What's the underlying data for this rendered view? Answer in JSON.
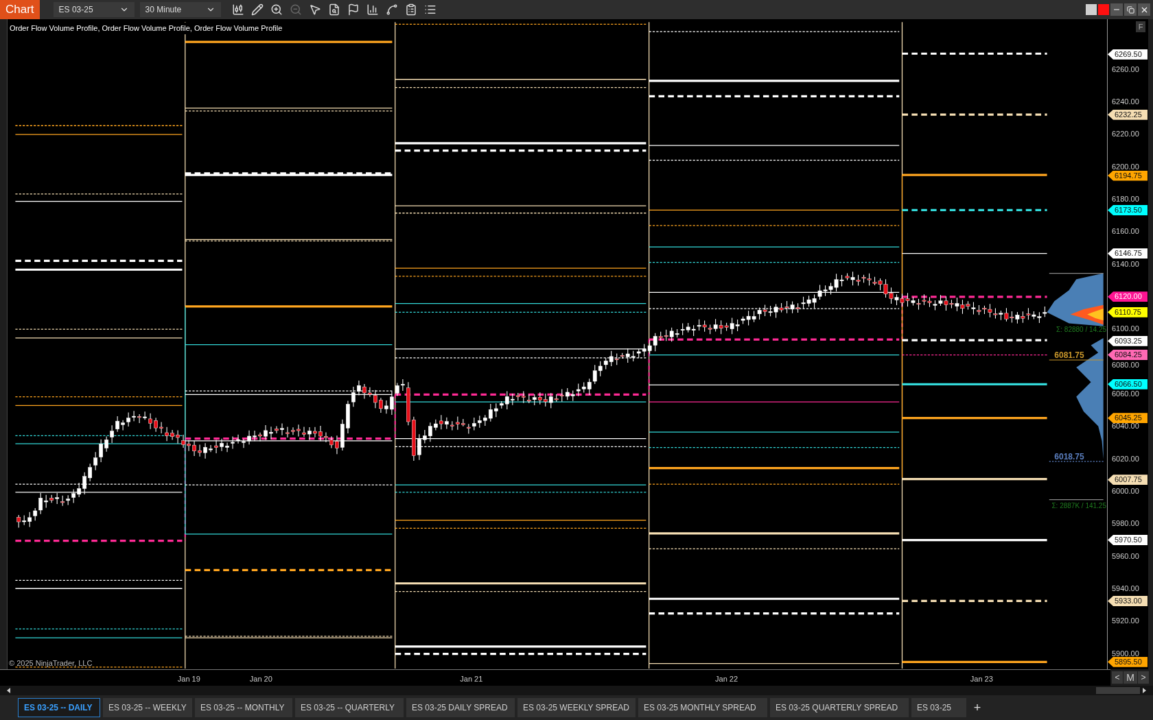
{
  "window": {
    "title": "Chart"
  },
  "toolbar": {
    "instrument": "ES 03-25",
    "interval": "30 Minute"
  },
  "chart": {
    "indicator_label": "Order Flow Volume Profile, Order Flow Volume Profile, Order Flow Volume Profile",
    "copyright": "© 2025 NinjaTrader, LLC",
    "corner_button": "F",
    "profile_labels": [
      {
        "text": "Σ: 82880 / 14.25",
        "color": "#1f7a1f"
      },
      {
        "text": "6081.75",
        "color": "#c8962a"
      },
      {
        "text": "6018.75",
        "color": "#5b7fc0"
      },
      {
        "text": "Σ: 2887K / 141.25",
        "color": "#1f7a1f"
      }
    ]
  },
  "price_axis": {
    "ticks": [
      "6260.00",
      "6240.00",
      "6220.00",
      "6200.00",
      "6180.00",
      "6160.00",
      "6140.00",
      "6100.00",
      "6080.00",
      "6060.00",
      "6040.00",
      "6020.00",
      "6000.00",
      "5980.00",
      "5960.00",
      "5940.00",
      "5920.00",
      "5900.00"
    ],
    "price_tags": [
      {
        "text": "6269.50",
        "color": "#ffffff"
      },
      {
        "text": "6232.25",
        "color": "#f5deb3"
      },
      {
        "text": "6194.75",
        "color": "#ffa500"
      },
      {
        "text": "6173.50",
        "color": "#00ffff"
      },
      {
        "text": "6146.75",
        "color": "#ffffff"
      },
      {
        "text": "6120.00",
        "color": "#ff1493"
      },
      {
        "text": "6110.75",
        "color": "#ffff00"
      },
      {
        "text": "6093.25",
        "color": "#ffffff"
      },
      {
        "text": "6084.25",
        "color": "#ff69b4"
      },
      {
        "text": "6066.50",
        "color": "#00ffff"
      },
      {
        "text": "6045.25",
        "color": "#ffa500"
      },
      {
        "text": "6007.75",
        "color": "#f5deb3"
      },
      {
        "text": "5970.50",
        "color": "#ffffff"
      },
      {
        "text": "5933.00",
        "color": "#f5deb3"
      },
      {
        "text": "5895.50",
        "color": "#ffa500"
      }
    ]
  },
  "time_axis": {
    "labels": [
      "Jan 19",
      "Jan 20",
      "Jan 21",
      "Jan 22",
      "Jan 23"
    ]
  },
  "nav_buttons": [
    "<",
    "M",
    ">"
  ],
  "tabs": [
    {
      "label": "ES 03-25 -- DAILY",
      "selected": true
    },
    {
      "label": "ES 03-25 -- WEEKLY",
      "selected": false
    },
    {
      "label": "ES 03-25 -- MONTHLY",
      "selected": false
    },
    {
      "label": "ES 03-25 -- QUARTERLY",
      "selected": false
    },
    {
      "label": "ES 03-25 DAILY SPREAD",
      "selected": false
    },
    {
      "label": "ES 03-25 WEEKLY SPREAD",
      "selected": false
    },
    {
      "label": "ES 03-25 MONTHLY SPREAD",
      "selected": false
    },
    {
      "label": "ES 03-25 QUARTERLY SPREAD",
      "selected": false
    },
    {
      "label": "ES 03-25",
      "selected": false
    }
  ],
  "add_tab": "+"
}
